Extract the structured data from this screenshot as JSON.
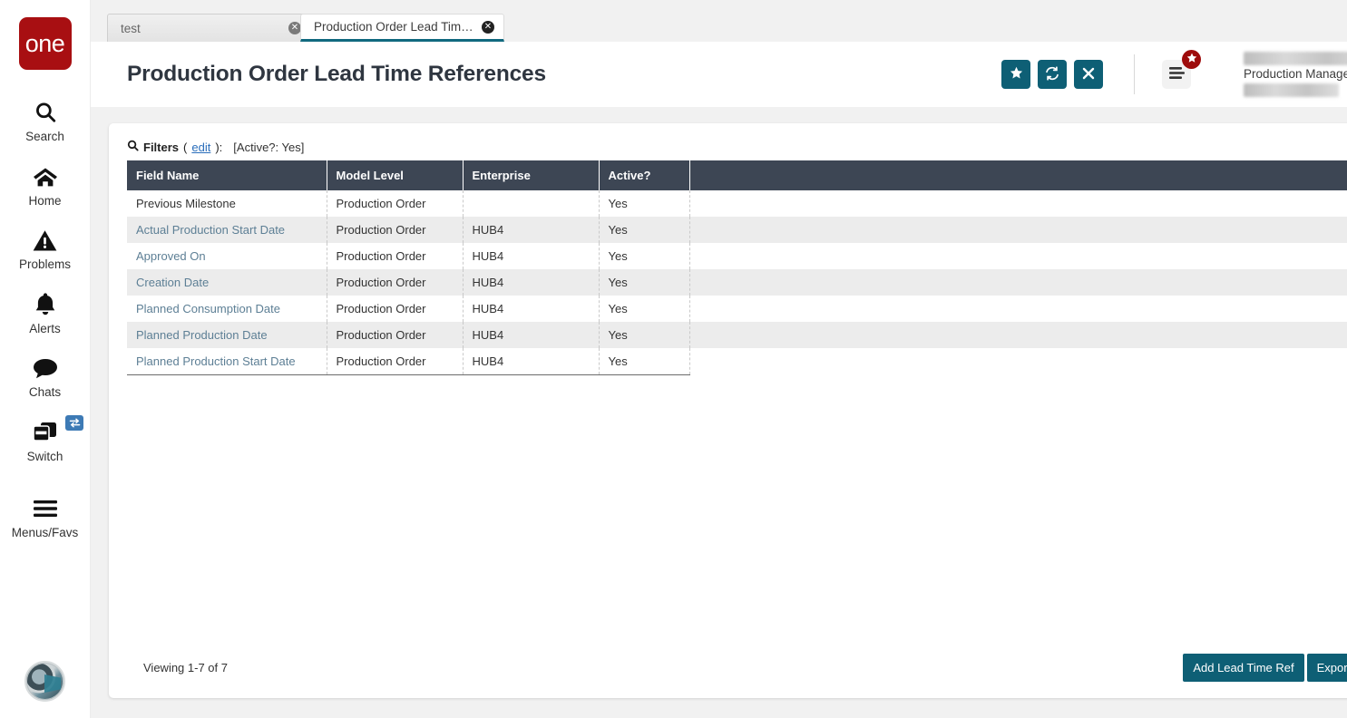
{
  "brand": {
    "logo_text": "one",
    "logo_color": "#a80f12"
  },
  "theme": {
    "accent_teal": "#0e5f75",
    "table_header": "#3d4654",
    "link_blue": "#2a6ebb",
    "row_link": "#5d7f95",
    "badge_red": "#9e0b0b"
  },
  "sidebar": {
    "items": [
      {
        "label": "Search",
        "icon": "search-icon"
      },
      {
        "label": "Home",
        "icon": "home-icon"
      },
      {
        "label": "Problems",
        "icon": "warning-triangle-icon"
      },
      {
        "label": "Alerts",
        "icon": "bell-icon"
      },
      {
        "label": "Chats",
        "icon": "chat-bubble-icon"
      },
      {
        "label": "Switch",
        "icon": "windows-stack-icon",
        "badge_icon": "swap-arrows-icon"
      },
      {
        "label": "Menus/Favs",
        "icon": "hamburger-icon"
      }
    ],
    "avatar_label": "user-avatar"
  },
  "tabs": [
    {
      "label": "test",
      "active": false,
      "close_icon": "close-circle-icon"
    },
    {
      "label": "Production Order Lead Time Ref...",
      "active": true,
      "close_icon": "close-circle-icon"
    }
  ],
  "header": {
    "title": "Production Order Lead Time References",
    "actions": [
      {
        "name": "favorite-button",
        "icon": "star-icon"
      },
      {
        "name": "refresh-button",
        "icon": "refresh-icon"
      },
      {
        "name": "close-button",
        "icon": "x-icon"
      }
    ],
    "menu_button": {
      "icon": "hamburger-icon",
      "badge_icon": "star-icon"
    },
    "user": {
      "role": "Production Manager",
      "dropdown_icon": "chevron-down-icon"
    }
  },
  "filters": {
    "icon": "search-icon",
    "label": "Filters",
    "open_paren": "(",
    "edit_link": "edit",
    "close_paren": "):",
    "values": "[Active?: Yes]"
  },
  "table": {
    "columns": [
      "Field Name",
      "Model Level",
      "Enterprise",
      "Active?",
      ""
    ],
    "rows": [
      {
        "field_name": "Previous Milestone",
        "model_level": "Production Order",
        "enterprise": "",
        "active": "Yes",
        "is_link": false
      },
      {
        "field_name": "Actual Production Start Date",
        "model_level": "Production Order",
        "enterprise": "HUB4",
        "active": "Yes",
        "is_link": true
      },
      {
        "field_name": "Approved On",
        "model_level": "Production Order",
        "enterprise": "HUB4",
        "active": "Yes",
        "is_link": true
      },
      {
        "field_name": "Creation Date",
        "model_level": "Production Order",
        "enterprise": "HUB4",
        "active": "Yes",
        "is_link": true
      },
      {
        "field_name": "Planned Consumption Date",
        "model_level": "Production Order",
        "enterprise": "HUB4",
        "active": "Yes",
        "is_link": true
      },
      {
        "field_name": "Planned Production Date",
        "model_level": "Production Order",
        "enterprise": "HUB4",
        "active": "Yes",
        "is_link": true
      },
      {
        "field_name": "Planned Production Start Date",
        "model_level": "Production Order",
        "enterprise": "HUB4",
        "active": "Yes",
        "is_link": true
      }
    ]
  },
  "footer": {
    "viewing": "Viewing 1-7 of 7",
    "add_button": "Add Lead Time Ref",
    "export_button": "Export to CSV"
  }
}
